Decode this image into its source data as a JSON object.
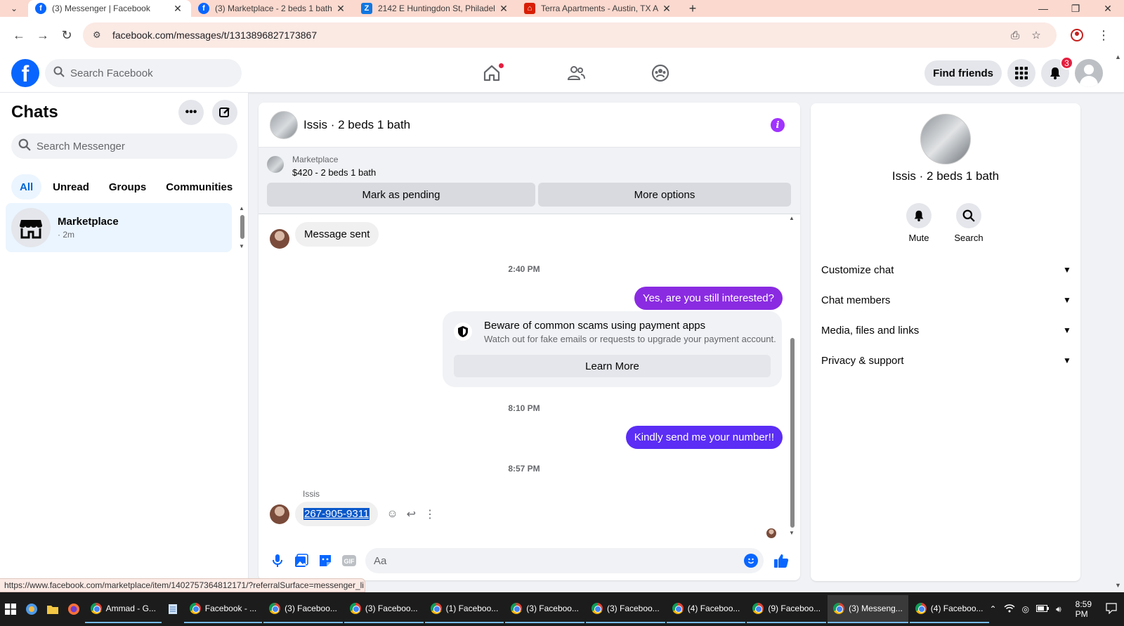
{
  "browser": {
    "tabs": [
      {
        "title": "(3) Messenger | Facebook",
        "icon": "facebook-icon",
        "active": true
      },
      {
        "title": "(3) Marketplace - 2 beds 1 bath",
        "icon": "facebook-icon",
        "active": false
      },
      {
        "title": "2142 E Huntingdon St, Philadel",
        "icon": "zillow-icon",
        "active": false
      },
      {
        "title": "Terra Apartments - Austin, TX A",
        "icon": "apartments-icon",
        "active": false
      }
    ],
    "url": "facebook.com/messages/t/1313896827173867",
    "status_link": "https://www.facebook.com/marketplace/item/1402757364812171/?referralSurface=messenger_li..."
  },
  "fb_header": {
    "search_placeholder": "Search Facebook",
    "find_friends_label": "Find friends",
    "notification_count": "3",
    "brand_color": "#0866ff"
  },
  "sidebar": {
    "title": "Chats",
    "search_placeholder": "Search Messenger",
    "filters": [
      "All",
      "Unread",
      "Groups",
      "Communities"
    ],
    "active_filter": "All",
    "chats": [
      {
        "name": "Marketplace",
        "sub": "· 2m"
      }
    ]
  },
  "conversation": {
    "title": "Issis · 2 beds 1 bath",
    "marketplace": {
      "label": "Marketplace",
      "price_title": "$420 - 2 beds 1 bath",
      "mark_pending_label": "Mark as pending",
      "more_options_label": "More options"
    },
    "messages": {
      "sent_notice": "Message sent",
      "time1": "2:40 PM",
      "out1": "Yes, are you still interested?",
      "scam_title": "Beware of common scams using payment apps",
      "scam_sub": "Watch out for fake emails or requests to upgrade your payment account.",
      "learn_more_label": "Learn More",
      "time2": "8:10 PM",
      "out2": "Kindly send me your number!!",
      "time3": "8:57 PM",
      "sender_name": "Issis",
      "phone": "267-905-9311"
    },
    "composer_placeholder": "Aa",
    "accent_color": "#8a2be2"
  },
  "info_panel": {
    "name": "Issis · 2 beds 1 bath",
    "actions": [
      {
        "label": "Mute",
        "icon": "bell-icon"
      },
      {
        "label": "Search",
        "icon": "search-icon"
      }
    ],
    "sections": [
      "Customize chat",
      "Chat members",
      "Media, files and links",
      "Privacy & support"
    ]
  },
  "taskbar": {
    "apps": [
      {
        "label": "Ammad - G...",
        "active": false
      },
      {
        "label": "Facebook - ...",
        "active": false
      },
      {
        "label": "(3) Faceboo...",
        "active": false
      },
      {
        "label": "(3) Faceboo...",
        "active": false
      },
      {
        "label": "(1) Faceboo...",
        "active": false
      },
      {
        "label": "(3) Faceboo...",
        "active": false
      },
      {
        "label": "(3) Faceboo...",
        "active": false
      },
      {
        "label": "(4) Faceboo...",
        "active": false
      },
      {
        "label": "(9) Faceboo...",
        "active": false
      },
      {
        "label": "(3) Messeng...",
        "active": true
      },
      {
        "label": "(4) Faceboo...",
        "active": false
      }
    ],
    "clock": "8:59 PM"
  }
}
